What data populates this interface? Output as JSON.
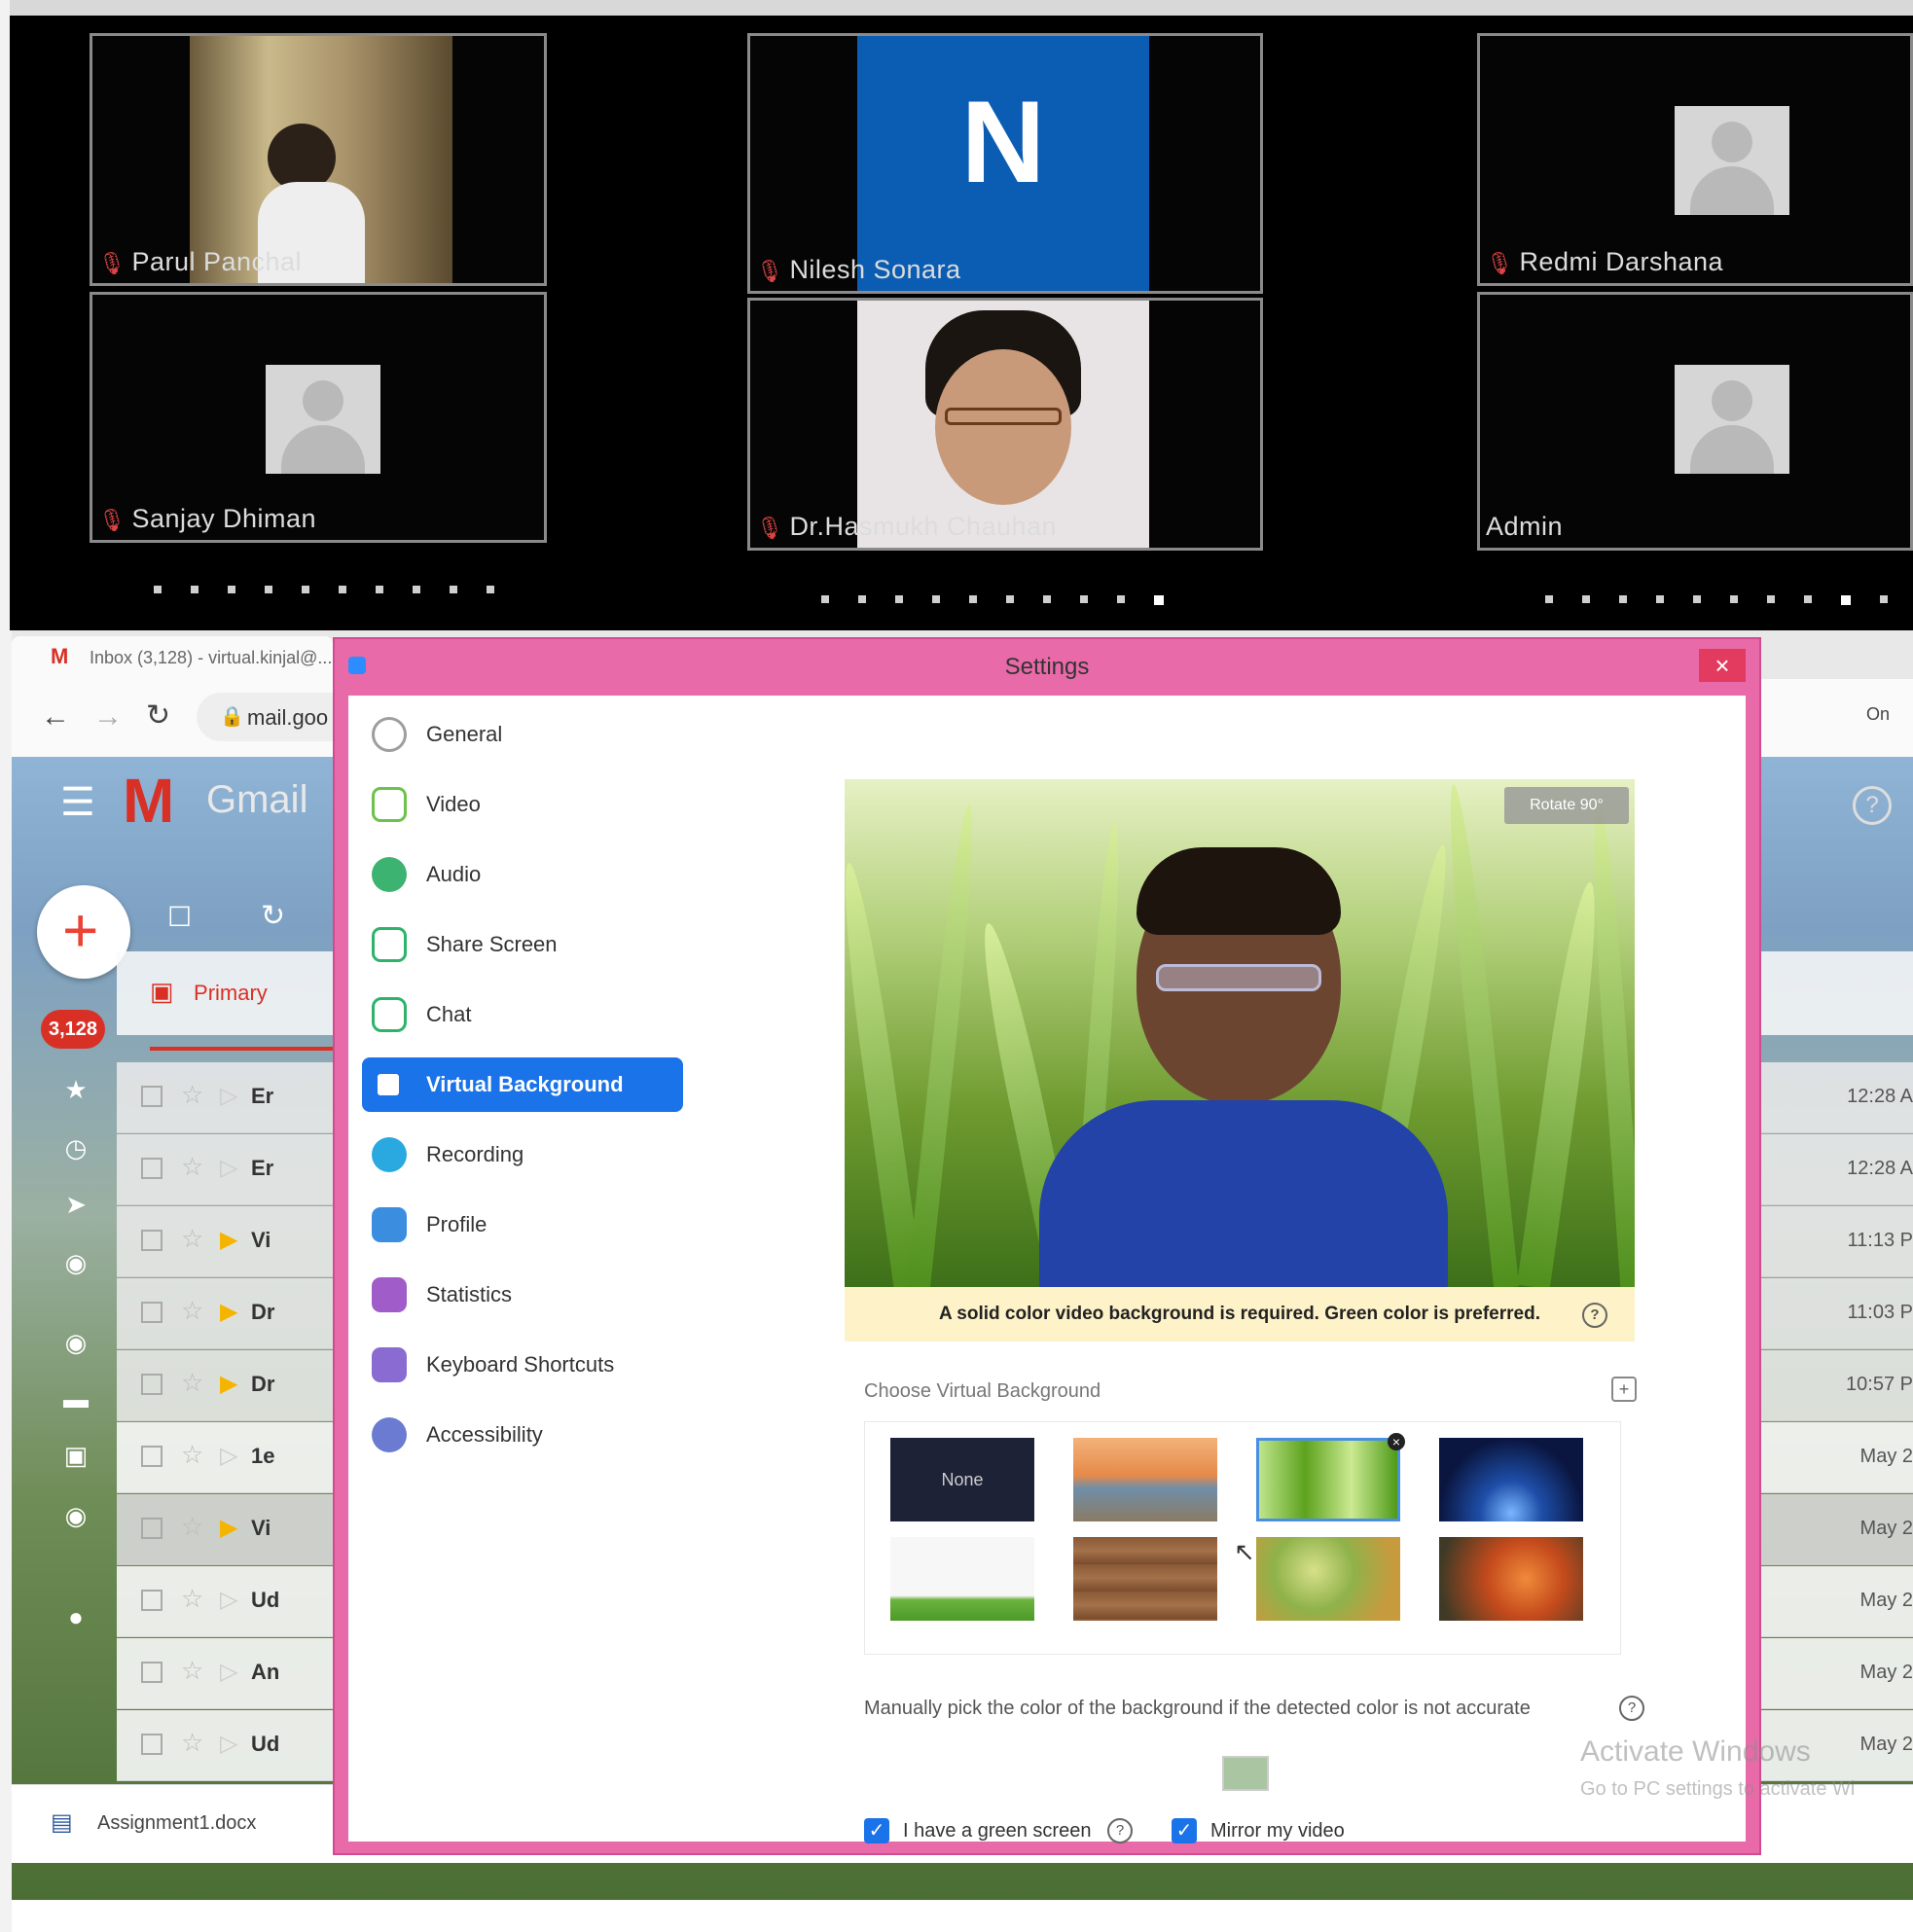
{
  "gallery": {
    "tiles": [
      {
        "name": "Parul Panchal"
      },
      {
        "name": "Nilesh Sonara",
        "initial": "N"
      },
      {
        "name": "Redmi Darshana"
      },
      {
        "name": "Sanjay Dhiman"
      },
      {
        "name": "Dr.Hasmukh Chauhan"
      },
      {
        "name": "Admin"
      }
    ]
  },
  "browser": {
    "tab_title": "Inbox (3,128) - virtual.kinjal@...",
    "url": "mail.goo",
    "gmail_label": "Gmail",
    "tab_primary": "Primary",
    "unread_badge": "3,128",
    "mail_rows": [
      {
        "sender": "Er",
        "date": "12:28 A"
      },
      {
        "sender": "Er",
        "date": "12:28 A"
      },
      {
        "sender": "Vi",
        "date": "11:13 P"
      },
      {
        "sender": "Dr",
        "date": "11:03 P"
      },
      {
        "sender": "Dr",
        "date": "10:57 P"
      },
      {
        "sender": "1e",
        "date": "May 2"
      },
      {
        "sender": "Vi",
        "date": "May 2"
      },
      {
        "sender": "Ud",
        "date": "May 2"
      },
      {
        "sender": "An",
        "date": "May 2"
      },
      {
        "sender": "Ud",
        "date": "May 2"
      }
    ],
    "download_file": "Assignment1.docx"
  },
  "settings": {
    "title": "Settings",
    "nav": [
      {
        "label": "General",
        "color": "#9e9e9e"
      },
      {
        "label": "Video",
        "color": "#6cc24a"
      },
      {
        "label": "Audio",
        "color": "#3cb371"
      },
      {
        "label": "Share Screen",
        "color": "#2fb36b"
      },
      {
        "label": "Chat",
        "color": "#2fb36b"
      },
      {
        "label": "Virtual Background",
        "color": "#1a73e8"
      },
      {
        "label": "Recording",
        "color": "#29a9e0"
      },
      {
        "label": "Profile",
        "color": "#3b8de0"
      },
      {
        "label": "Statistics",
        "color": "#a05cc8"
      },
      {
        "label": "Keyboard Shortcuts",
        "color": "#8a6bd1"
      },
      {
        "label": "Accessibility",
        "color": "#6a7bd1"
      }
    ],
    "rotate_label": "Rotate 90°",
    "banner": "A solid color video background is required. Green color is preferred.",
    "choose_label": "Choose Virtual Background",
    "none_label": "None",
    "manual_text": "Manually pick the color of the background if the detected color is not accurate",
    "green_screen_label": "I have a green screen",
    "mirror_label": "Mirror my video"
  },
  "watermark": {
    "line1": "Activate Windows",
    "line2": "Go to PC settings to activate Wi"
  }
}
